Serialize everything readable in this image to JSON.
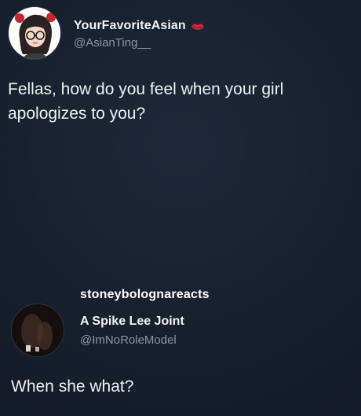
{
  "top_tweet": {
    "display_name": "YourFavoriteAsian",
    "handle": "@AsianTing__",
    "text": "Fellas, how do you feel when your girl apologizes to you?",
    "name_badge_icon": "lips-emoji-icon",
    "avatar_icon": "avatar-girl-glasses-icon"
  },
  "reply": {
    "overlay_caption": "stoneybolognareacts",
    "display_name": "A Spike Lee Joint",
    "handle": "@ImNoRoleModel",
    "text": "When she what?",
    "avatar_icon": "avatar-dark-photo-icon"
  },
  "colors": {
    "background": "#1a2331",
    "text": "#eef1f4",
    "handle": "#8a97a6",
    "lips": "#d6253a"
  }
}
